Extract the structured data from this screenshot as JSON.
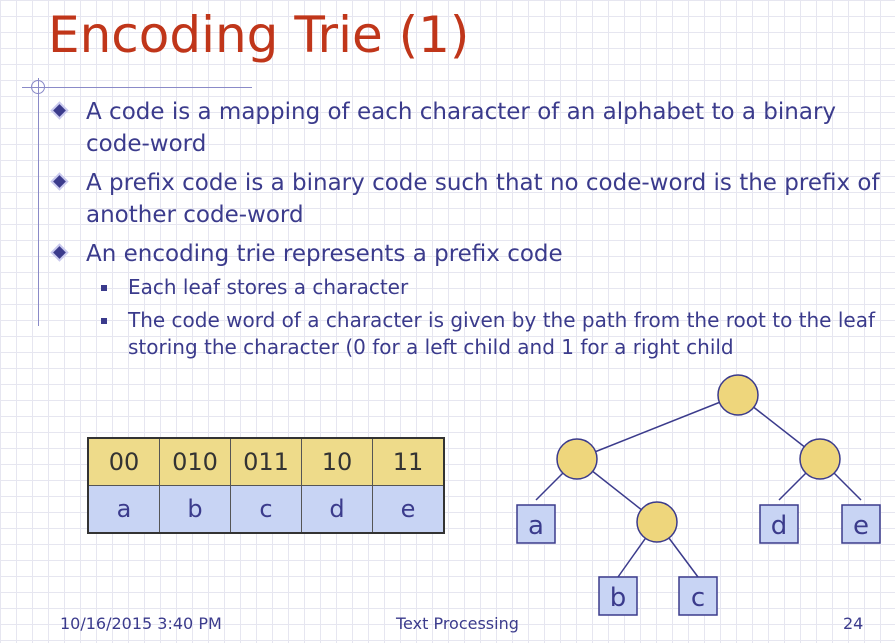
{
  "title": "Encoding Trie (1)",
  "bullets": [
    {
      "text": "A code is a mapping of each character of an alphabet to a binary code-word"
    },
    {
      "text": "A prefix code is a binary code such that no code-word is the prefix of another code-word"
    },
    {
      "text": "An encoding trie represents a prefix code"
    }
  ],
  "sub_bullets": [
    {
      "text": "Each leaf stores a character"
    },
    {
      "text": "The code word of a character is given by the path from the root to the leaf storing the character (0 for a left child and 1 for a right child"
    }
  ],
  "table": {
    "codes": [
      "00",
      "010",
      "011",
      "10",
      "11"
    ],
    "chars": [
      "a",
      "b",
      "c",
      "d",
      "e"
    ]
  },
  "trie": {
    "leaves": [
      "a",
      "b",
      "c",
      "d",
      "e"
    ]
  },
  "footer": {
    "date": "10/16/2015 3:40 PM",
    "center": "Text Processing",
    "page": "24"
  },
  "colors": {
    "title": "#c0361a",
    "text": "#3b3b8c",
    "node_fill": "#eed67c",
    "leaf_fill": "#c8d4f4",
    "table_code_bg": "#eedb8a",
    "table_char_bg": "#c8d4f4"
  }
}
